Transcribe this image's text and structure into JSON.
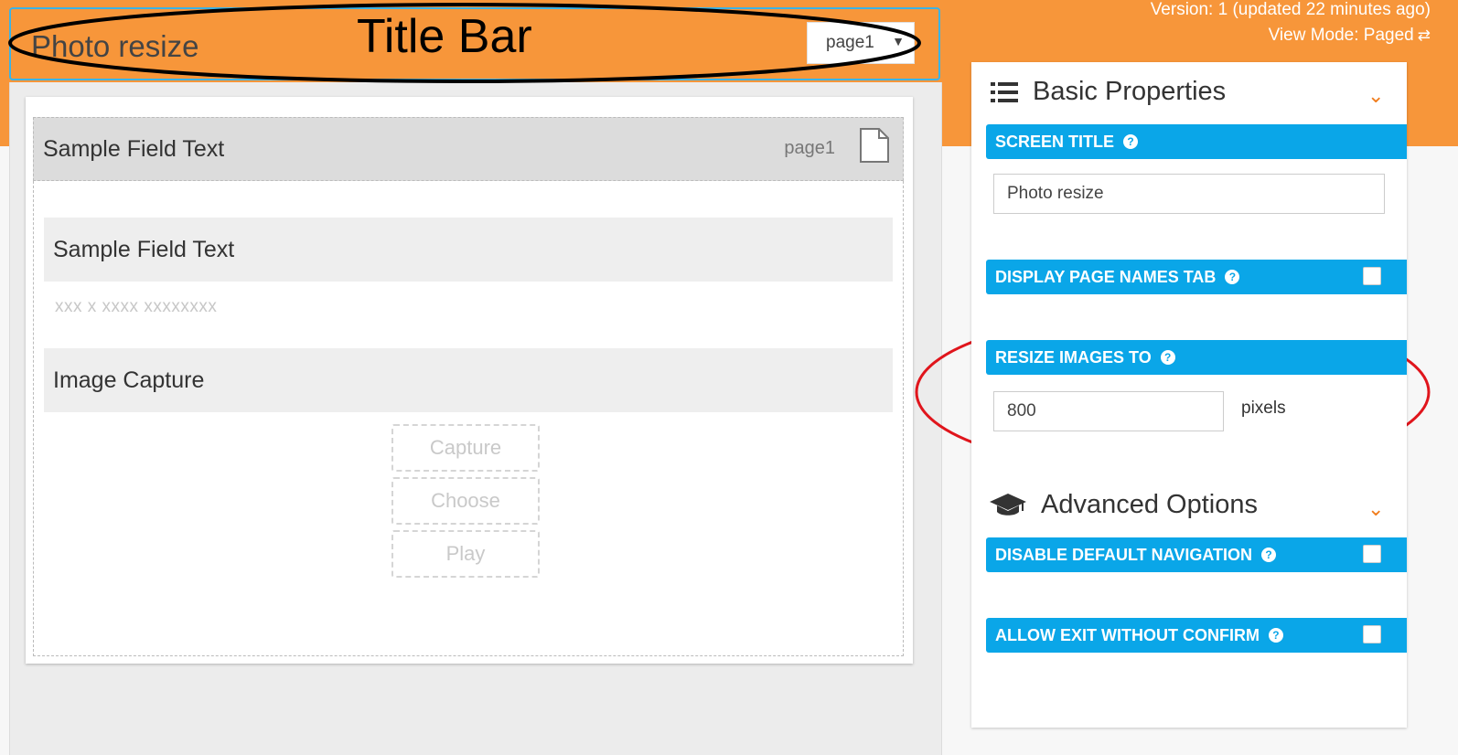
{
  "header": {
    "version": "Version: 1 (updated 22 minutes ago)",
    "view_mode": "View Mode: Paged",
    "view_mode_icon": "swap-icon"
  },
  "phone": {
    "title": "Photo resize",
    "page_select": "page1",
    "annotation": "Title Bar"
  },
  "page": {
    "header_label": "Sample Field Text",
    "page_name": "page1",
    "fields": [
      {
        "label": "Sample Field Text",
        "placeholder": "xxx x xxxx xxxxxxxx"
      },
      {
        "label": "Image Capture"
      }
    ],
    "buttons": [
      "Capture",
      "Choose",
      "Play"
    ]
  },
  "panel": {
    "basic_title": "Basic Properties",
    "screen_title_label": "SCREEN TITLE",
    "screen_title_value": "Photo resize",
    "display_page_names_label": "DISPLAY PAGE NAMES TAB",
    "resize_label": "RESIZE IMAGES TO",
    "resize_value": "800",
    "resize_unit": "pixels",
    "advanced_title": "Advanced Options",
    "disable_nav_label": "DISABLE DEFAULT NAVIGATION",
    "allow_exit_label": "ALLOW EXIT WITHOUT CONFIRM"
  },
  "colors": {
    "orange": "#f7963a",
    "blue": "#0aa6e8",
    "annotation_red": "#e0151c"
  }
}
